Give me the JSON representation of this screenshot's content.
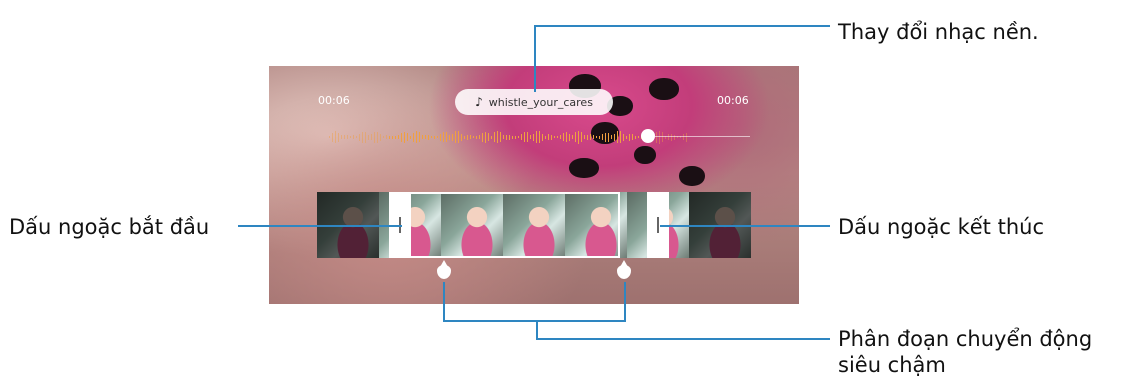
{
  "callouts": {
    "change_music": "Thay đổi nhạc nền.",
    "start_bracket": "Dấu ngoặc bắt đầu",
    "end_bracket": "Dấu ngoặc kết thúc",
    "slow_motion_line1": "Phân đoạn chuyển động",
    "slow_motion_line2": "siêu chậm"
  },
  "editor": {
    "time_start": "00:06",
    "time_end": "00:06",
    "music_name": "whistle_your_cares",
    "music_icon": "music-note-icon",
    "note_glyph": "♪"
  },
  "colors": {
    "callout_line": "#2e86c1",
    "waveform": "#f0a040"
  }
}
